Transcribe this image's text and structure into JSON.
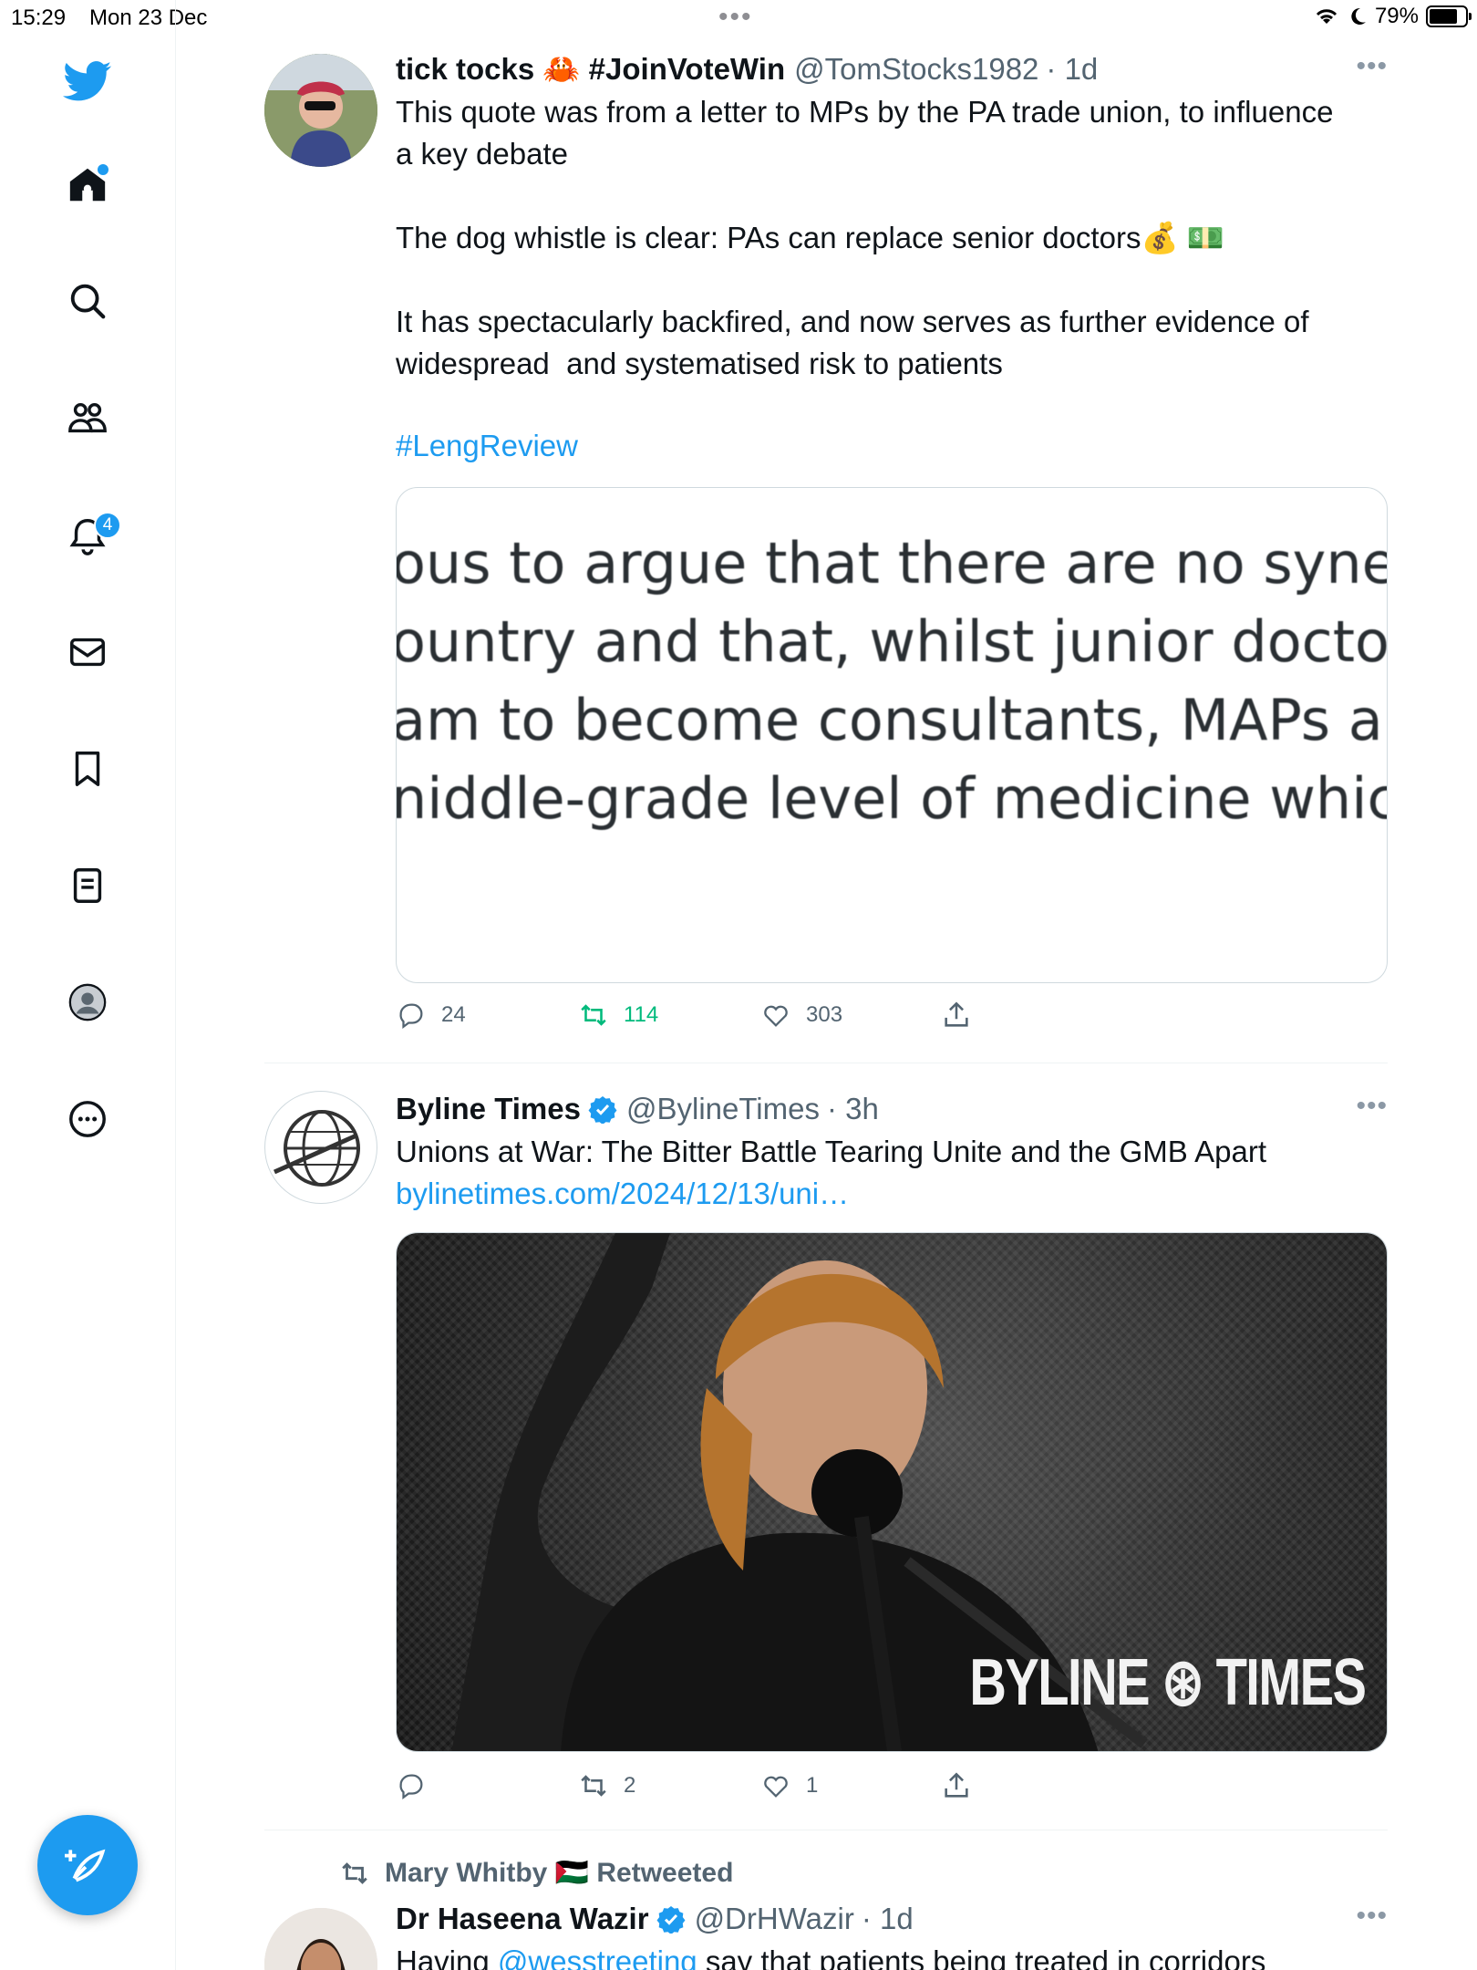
{
  "status_bar": {
    "time": "15:29",
    "date": "Mon 23 Dec",
    "battery": "79%",
    "battery_level": 0.79
  },
  "sidebar": {
    "items": [
      {
        "name": "home",
        "icon": "home-icon"
      },
      {
        "name": "explore",
        "icon": "search-icon"
      },
      {
        "name": "communities",
        "icon": "communities-icon"
      },
      {
        "name": "notifications",
        "icon": "bell-icon",
        "badge": "4"
      },
      {
        "name": "messages",
        "icon": "envelope-icon"
      },
      {
        "name": "bookmarks",
        "icon": "bookmark-icon"
      },
      {
        "name": "lists",
        "icon": "list-icon"
      },
      {
        "name": "profile",
        "icon": "profile-icon"
      },
      {
        "name": "more",
        "icon": "more-circle-icon"
      }
    ],
    "compose_icon": "compose-feather-icon"
  },
  "tweets": [
    {
      "display_name": "tick tocks 🦀 #JoinVoteWin",
      "handle": "@TomStocks1982",
      "time": "· 1d",
      "text": "This quote was from a letter to MPs by the PA trade union, to influence\na key debate\n\nThe dog whistle is clear: PAs can replace senior doctors💰 💵\n\nIt has spectacularly backfired, and now serves as further evidence of\nwidespread  and systematised risk to patients",
      "hashtag": "#LengReview",
      "quote_lines": [
        "ous to argue that there are no synerg",
        "ountry and that, whilst junior doctors",
        "am to become consultants, MAPs are",
        "niddle-grade level of medicine which"
      ],
      "replies": "24",
      "retweets": "114",
      "likes": "303"
    },
    {
      "display_name": "Byline Times",
      "verified": true,
      "handle": "@BylineTimes",
      "time": "· 3h",
      "text": "Unions at War: The Bitter Battle Tearing Unite and the GMB Apart",
      "link": "bylinetimes.com/2024/12/13/uni…",
      "image_brand": "BYLINE ⊛ TIMES",
      "replies": "",
      "retweets": "2",
      "likes": "1"
    },
    {
      "retweeted_by": "Mary Whitby 🇵🇸 Retweeted",
      "display_name": "Dr Haseena Wazir",
      "verified": true,
      "handle": "@DrHWazir",
      "time": "· 1d",
      "text_start": "Having ",
      "mention": "@wesstreeting",
      "text_rest": " say that patients being treated in corridors"
    }
  ],
  "colors": {
    "accent": "#1d9bf0",
    "retweet_green": "#00ba7c",
    "secondary_text": "#536471"
  }
}
